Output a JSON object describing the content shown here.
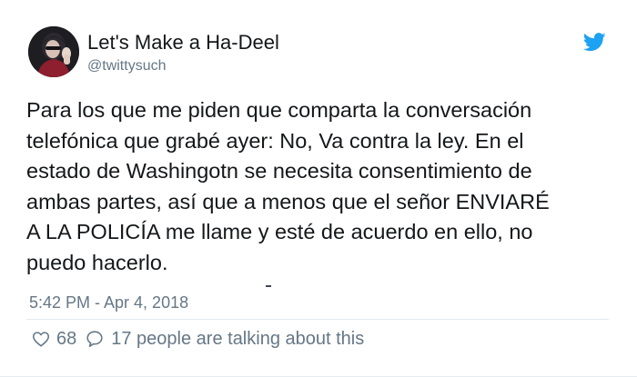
{
  "author": {
    "display_name": "Let's Make a Ha-Deel",
    "handle": "@twittysuch",
    "avatar_icon": "profile-photo"
  },
  "brand": {
    "icon": "twitter-bird-icon",
    "color": "#1da1f2"
  },
  "tweet": {
    "text": "Para los que me piden que comparta la conversación\ntelefónica que grabé ayer: No, Va contra la ley. En el\nestado de Washingotn se necesita consentimiento de\nambas partes, así que a menos que el señor ENVIARÉ\nA LA POLICÍA me llame y esté de acuerdo en ello, no\npuedo hacerlo.",
    "timestamp": "5:42 PM - Apr 4, 2018"
  },
  "actions": {
    "like_icon": "heart-icon",
    "like_count": "68",
    "reply_icon": "speech-bubble-icon",
    "talking_text": "17 people are talking about this"
  },
  "colors": {
    "text_primary": "#14171a",
    "text_secondary": "#657786",
    "divider": "#e1e8ed"
  }
}
